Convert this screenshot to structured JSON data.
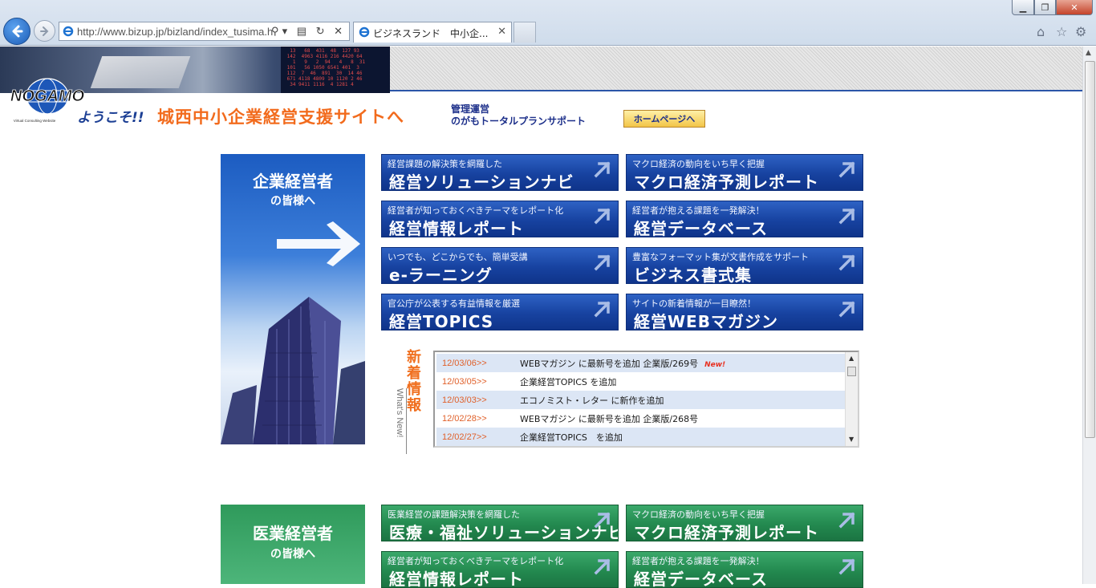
{
  "browser": {
    "url": "http://www.bizup.jp/bizland/index_tusima.h",
    "tab_title": "ビジネスランド　中小企...",
    "close_tab": "✕"
  },
  "header": {
    "logo_text": "NOGAMO",
    "logo_sub": "Virtual Consulting Website",
    "welcome": "ようこそ!!",
    "site_name": "城西中小企業経営支援サイトへ",
    "management_label": "管理運営",
    "management_name": "のがもトータルプランサポート",
    "home_button": "ホームページへ"
  },
  "corporate": {
    "title": "企業経営者",
    "subtitle": "の皆様へ",
    "buttons": [
      {
        "sub": "経営課題の解決策を網羅した",
        "main": "経営ソリューションナビ"
      },
      {
        "sub": "マクロ経済の動向をいち早く把握",
        "main": "マクロ経済予測レポート"
      },
      {
        "sub": "経営者が知っておくべきテーマをレポート化",
        "main": "経営情報レポート"
      },
      {
        "sub": "経営者が抱える課題を一発解決！",
        "main": "経営データベース"
      },
      {
        "sub": "いつでも、どこからでも、簡単受講",
        "main": "e-ラーニング"
      },
      {
        "sub": "豊富なフォーマット集が文書作成をサポート",
        "main": "ビジネス書式集"
      },
      {
        "sub": "官公庁が公表する有益情報を厳選",
        "main": "経営TOPICS"
      },
      {
        "sub": "サイトの新着情報が一目瞭然！",
        "main": "経営WEBマガジン"
      }
    ]
  },
  "news": {
    "label": "新着情報",
    "label_en": "What's New!",
    "new_badge": "New!",
    "items": [
      {
        "date": "12/03/06>>",
        "text": "WEBマガジン に最新号を追加 企業版/269号",
        "is_new": true
      },
      {
        "date": "12/03/05>>",
        "text": "企業経営TOPICS を追加",
        "is_new": false
      },
      {
        "date": "12/03/03>>",
        "text": "エコノミスト・レター に新作を追加",
        "is_new": false
      },
      {
        "date": "12/02/28>>",
        "text": "WEBマガジン に最新号を追加 企業版/268号",
        "is_new": false
      },
      {
        "date": "12/02/27>>",
        "text": "企業経営TOPICS　を追加",
        "is_new": false
      }
    ]
  },
  "medical": {
    "title": "医業経営者",
    "subtitle": "の皆様へ",
    "buttons": [
      {
        "sub": "医業経営の課題解決策を網羅した",
        "main": "医療・福祉ソリューションナビ"
      },
      {
        "sub": "マクロ経済の動向をいち早く把握",
        "main": "マクロ経済予測レポート"
      },
      {
        "sub": "経営者が知っておくべきテーマをレポート化",
        "main": "経営情報レポート"
      },
      {
        "sub": "経営者が抱える課題を一発解決！",
        "main": "経営データベース"
      }
    ]
  },
  "colors": {
    "accent_orange": "#f26b1d",
    "nav_blue": "#1742a0",
    "medical_green": "#23894f"
  }
}
